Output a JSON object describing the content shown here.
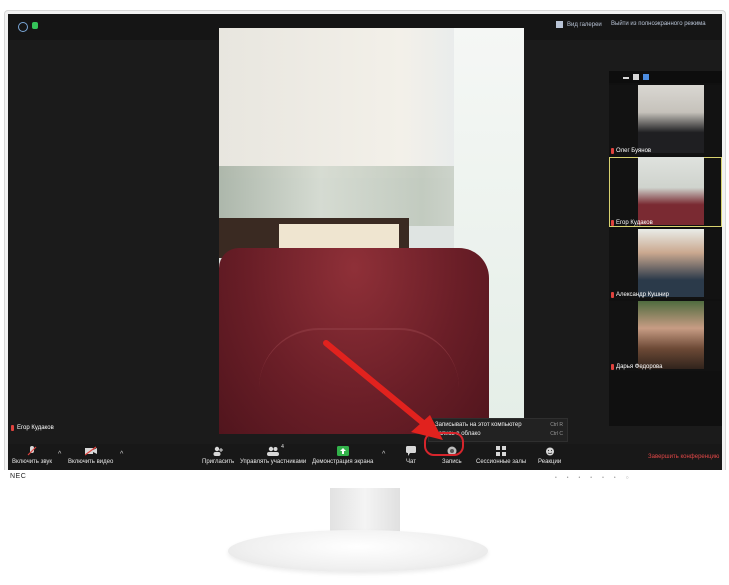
{
  "topbar": {
    "gallery_label": "Вид галереи",
    "exit_label": "Выйти из полноэкранного режима"
  },
  "main_video": {
    "participant_name": "Егор Кудаков"
  },
  "participants": [
    {
      "name": "Олег Буянов"
    },
    {
      "name": "Егор Кудаков"
    },
    {
      "name": "Александр Кушнир"
    },
    {
      "name": "Дарья Федорова"
    }
  ],
  "toolbar": {
    "unmute": "Включить звук",
    "start_video": "Включить видео",
    "invite": "Пригласить",
    "manage_participants": "Управлять участниками",
    "participants_count": "4",
    "share_screen": "Демонстрация экрана",
    "chat": "Чат",
    "record": "Запись",
    "breakout_rooms": "Сессионные залы",
    "reactions": "Реакции",
    "end_conference": "Завершить конференцию"
  },
  "record_menu": {
    "local": "Записывать на этот компьютер",
    "local_key": "Ctrl R",
    "cloud": "Запись в облако",
    "cloud_key": "Ctrl C"
  },
  "monitor": {
    "brand": "NEC"
  },
  "colors": {
    "end_red": "#e04646",
    "arrow_red": "#e1221e",
    "share_green": "#32b24a",
    "active_tile": "#d8d26f"
  }
}
